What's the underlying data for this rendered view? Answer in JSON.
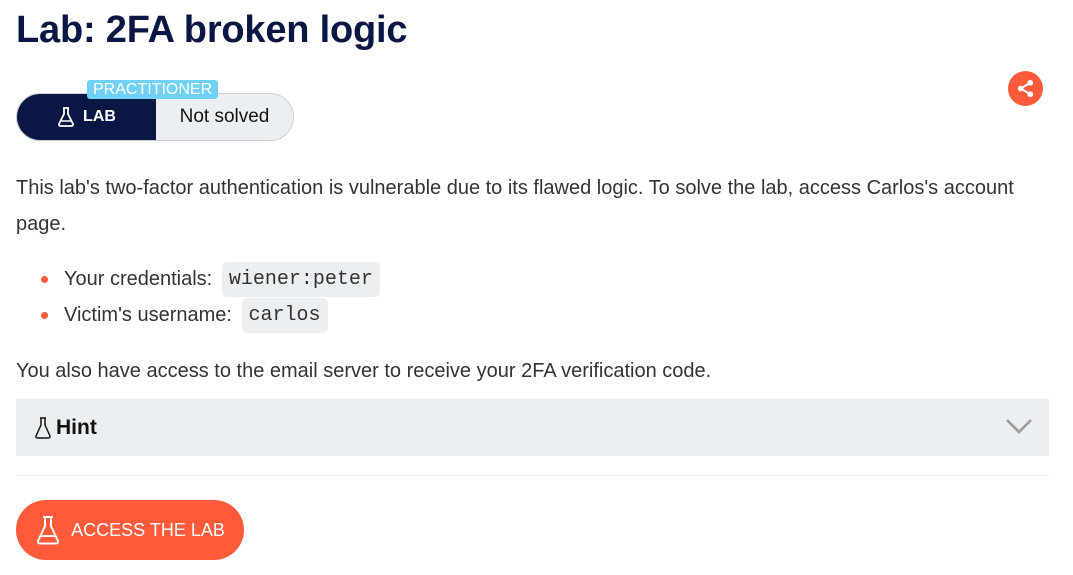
{
  "page": {
    "title": "Lab: 2FA broken logic"
  },
  "badge": {
    "level": "PRACTITIONER",
    "type_label": "LAB",
    "status": "Not solved",
    "dark_color": "#0a1744",
    "level_color": "#70d0f5"
  },
  "description": "This lab's two-factor authentication is vulnerable due to its flawed logic. To solve the lab, access Carlos's account page.",
  "credentials": [
    {
      "label": "Your credentials:",
      "value": "wiener:peter"
    },
    {
      "label": "Victim's username:",
      "value": "carlos"
    }
  ],
  "email_note": "You also have access to the email server to receive your 2FA verification code.",
  "hint": {
    "label": "Hint",
    "icon": "flask-icon",
    "expand_icon": "chevron-down-icon"
  },
  "access_button": {
    "label": "ACCESS THE LAB",
    "icon": "flask-icon",
    "color": "#ff5a3a"
  },
  "share": {
    "icon": "share-icon",
    "color": "#ff5a3a"
  }
}
